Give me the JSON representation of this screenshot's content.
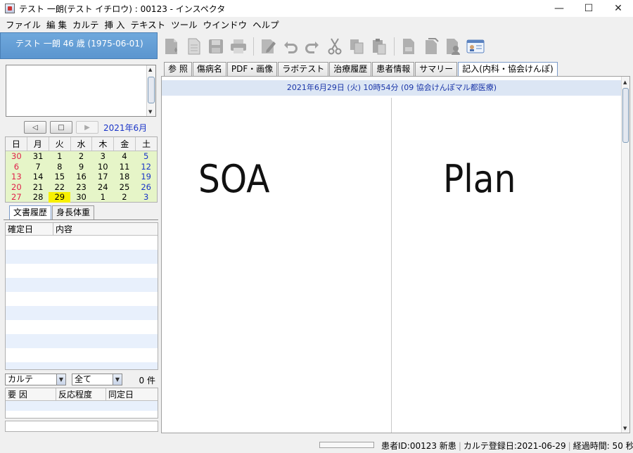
{
  "window": {
    "title": "テスト 一朗(テスト イチロウ) : 00123 - インスペクタ",
    "minimize": "—",
    "maximize": "☐",
    "close": "✕"
  },
  "menu": [
    "ファイル",
    "編 集",
    "カルテ",
    "挿 入",
    "テキスト",
    "ツール",
    "ウインドウ",
    "ヘルプ"
  ],
  "patient": {
    "header": "テスト 一朗  46 歳 (1975-06-01)"
  },
  "calendar": {
    "month_label": "2021年6月",
    "weekdays": [
      "日",
      "月",
      "火",
      "水",
      "木",
      "金",
      "土"
    ],
    "weeks": [
      [
        "30",
        "31",
        "1",
        "2",
        "3",
        "4",
        "5"
      ],
      [
        "6",
        "7",
        "8",
        "9",
        "10",
        "11",
        "12"
      ],
      [
        "13",
        "14",
        "15",
        "16",
        "17",
        "18",
        "19"
      ],
      [
        "20",
        "21",
        "22",
        "23",
        "24",
        "25",
        "26"
      ],
      [
        "27",
        "28",
        "29",
        "30",
        "1",
        "2",
        "3"
      ]
    ],
    "highlighted": "29"
  },
  "left_tabs": [
    "文書履歴",
    "身長体重"
  ],
  "doc_table": {
    "columns": [
      "確定日",
      "内容"
    ]
  },
  "filters": {
    "kind": "カルテ",
    "range": "全て",
    "count": "0 件"
  },
  "allergy_table": {
    "columns": [
      "要 因",
      "反応程度",
      "同定日"
    ]
  },
  "editor_tabs": [
    "参 照",
    "傷病名",
    "PDF・画像",
    "ラボテスト",
    "治療履歴",
    "患者情報",
    "サマリー",
    "記入(内科・協会けんぽ)"
  ],
  "editor": {
    "header": "2021年6月29日 (火) 10時54分 (09 協会けんぽマル都医療)",
    "soa_label": "SOA",
    "plan_label": "Plan"
  },
  "status": {
    "patient_id": "患者ID:00123 新患",
    "karte_date": "カルテ登録日:2021-06-29",
    "elapsed": "経過時間: 50 秒"
  }
}
